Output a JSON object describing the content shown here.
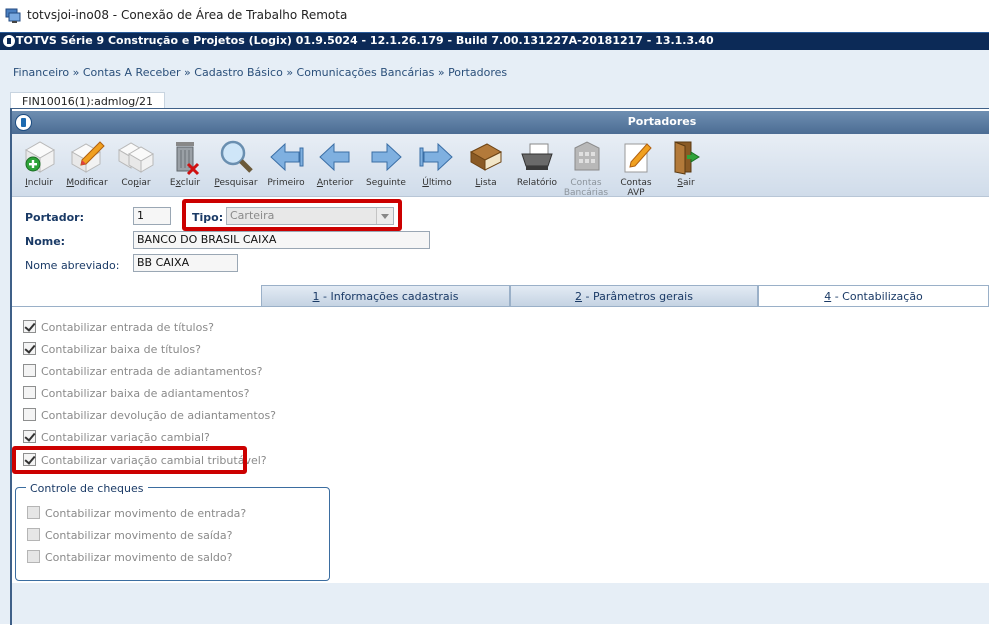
{
  "rdp": {
    "title": "totvsjoi-ino08 - Conexão de Área de Trabalho Remota"
  },
  "app": {
    "title": "TOTVS Série 9 Construção e Projetos (Logix) 01.9.5024   -  12.1.26.179  -  Build 7.00.131227A-20181217  -  13.1.3.40"
  },
  "breadcrumb": "Financeiro » Contas A Receber » Cadastro Básico » Comunicações Bancárias » Portadores",
  "window_tab": "FIN10016(1):admlog/21",
  "window_title": "Portadores",
  "toolbar": {
    "items": [
      {
        "label": "Incluir",
        "icon": "add-doc-icon",
        "enabled": true
      },
      {
        "label": "Modificar",
        "icon": "edit-doc-icon",
        "enabled": true
      },
      {
        "label": "Copiar",
        "icon": "copy-doc-icon",
        "enabled": true
      },
      {
        "label": "Excluir",
        "icon": "trash-icon",
        "enabled": true
      },
      {
        "label": "Pesquisar",
        "icon": "magnifier-icon",
        "enabled": true
      },
      {
        "label": "Primeiro",
        "icon": "first-arrow-icon",
        "enabled": true
      },
      {
        "label": "Anterior",
        "icon": "previous-arrow-icon",
        "enabled": true
      },
      {
        "label": "Seguinte",
        "icon": "next-arrow-icon",
        "enabled": true
      },
      {
        "label": "Último",
        "icon": "last-arrow-icon",
        "enabled": true
      },
      {
        "label": "Lista",
        "icon": "book-icon",
        "enabled": true
      },
      {
        "label": "Relatório",
        "icon": "printer-icon",
        "enabled": true
      },
      {
        "label": "Contas Bancárias",
        "icon": "bank-building-icon",
        "enabled": false
      },
      {
        "label": "Contas AVP",
        "icon": "avp-doc-icon",
        "enabled": true
      },
      {
        "label": "Sair",
        "icon": "exit-door-icon",
        "enabled": true
      }
    ]
  },
  "form": {
    "portador_label": "Portador:",
    "portador_value": "1",
    "tipo_label": "Tipo:",
    "tipo_value": "Carteira",
    "nome_label": "Nome:",
    "nome_value": "BANCO DO BRASIL CAIXA",
    "nome_abreviado_label": "Nome abreviado:",
    "nome_abreviado_value": "BB CAIXA"
  },
  "tabs": [
    {
      "num": "1",
      "label": " - Informações cadastrais",
      "active": false
    },
    {
      "num": "2",
      "label": " - Parâmetros gerais",
      "active": false
    },
    {
      "num": "4",
      "label": " - Contabilização",
      "active": true
    }
  ],
  "checks": [
    {
      "label": "Contabilizar entrada de títulos?",
      "checked": true
    },
    {
      "label": "Contabilizar baixa de títulos?",
      "checked": true
    },
    {
      "label": "Contabilizar entrada de adiantamentos?",
      "checked": false
    },
    {
      "label": "Contabilizar baixa de adiantamentos?",
      "checked": false
    },
    {
      "label": "Contabilizar devolução de adiantamentos?",
      "checked": false
    },
    {
      "label": "Contabilizar variação cambial?",
      "checked": true
    },
    {
      "label": "Contabilizar variação cambial tributável?",
      "checked": true
    }
  ],
  "cheques": {
    "title": "Controle de cheques",
    "items": [
      {
        "label": "Contabilizar movimento de entrada?",
        "checked": false
      },
      {
        "label": "Contabilizar movimento de saída?",
        "checked": false
      },
      {
        "label": "Contabilizar movimento de saldo?",
        "checked": false
      }
    ]
  },
  "colors": {
    "highlight": "#cc0000",
    "app_bar": "#0c2a57",
    "header": "#4b6c93"
  }
}
